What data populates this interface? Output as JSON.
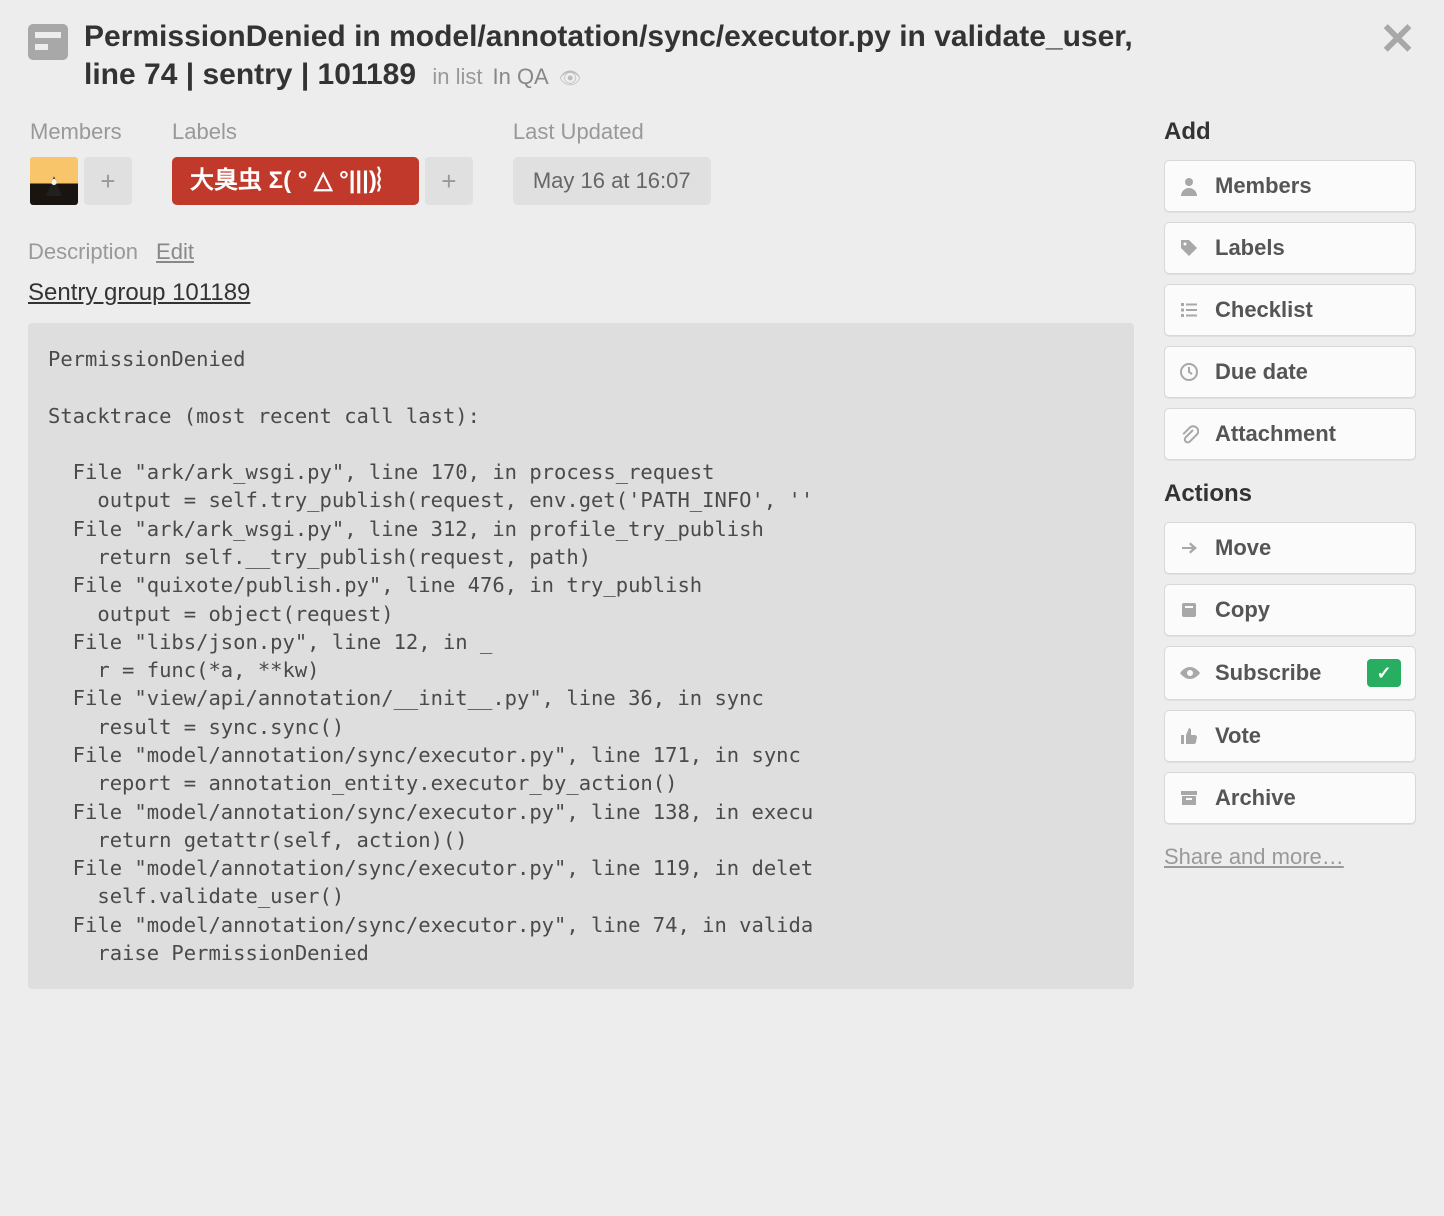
{
  "card": {
    "title": "PermissionDenied in model/annotation/sync/executor.py in validate_user, line 74 | sentry | 101189",
    "in_list_prefix": "in list",
    "list_name": "In QA"
  },
  "sections": {
    "members_label": "Members",
    "labels_label": "Labels",
    "last_updated_label": "Last Updated",
    "last_updated_value": "May 16 at 16:07",
    "label_tag": "大臭虫 Σ( ° △ °|||)︴"
  },
  "description": {
    "heading": "Description",
    "edit": "Edit",
    "link_text": "Sentry group 101189",
    "stacktrace": "PermissionDenied\n\nStacktrace (most recent call last):\n\n  File \"ark/ark_wsgi.py\", line 170, in process_request\n    output = self.try_publish(request, env.get('PATH_INFO', ''\n  File \"ark/ark_wsgi.py\", line 312, in profile_try_publish\n    return self.__try_publish(request, path)\n  File \"quixote/publish.py\", line 476, in try_publish\n    output = object(request)\n  File \"libs/json.py\", line 12, in _\n    r = func(*a, **kw)\n  File \"view/api/annotation/__init__.py\", line 36, in sync\n    result = sync.sync()\n  File \"model/annotation/sync/executor.py\", line 171, in sync\n    report = annotation_entity.executor_by_action()\n  File \"model/annotation/sync/executor.py\", line 138, in execu\n    return getattr(self, action)()\n  File \"model/annotation/sync/executor.py\", line 119, in delet\n    self.validate_user()\n  File \"model/annotation/sync/executor.py\", line 74, in valida\n    raise PermissionDenied"
  },
  "sidebar": {
    "add_heading": "Add",
    "actions_heading": "Actions",
    "add_items": [
      {
        "label": "Members",
        "icon": "user"
      },
      {
        "label": "Labels",
        "icon": "tag"
      },
      {
        "label": "Checklist",
        "icon": "checklist"
      },
      {
        "label": "Due date",
        "icon": "clock"
      },
      {
        "label": "Attachment",
        "icon": "clip"
      }
    ],
    "action_items": [
      {
        "label": "Move",
        "icon": "arrow"
      },
      {
        "label": "Copy",
        "icon": "copy"
      },
      {
        "label": "Subscribe",
        "icon": "eye",
        "checked": true
      },
      {
        "label": "Vote",
        "icon": "thumb"
      },
      {
        "label": "Archive",
        "icon": "archive"
      }
    ],
    "more_link": "Share and more…"
  }
}
